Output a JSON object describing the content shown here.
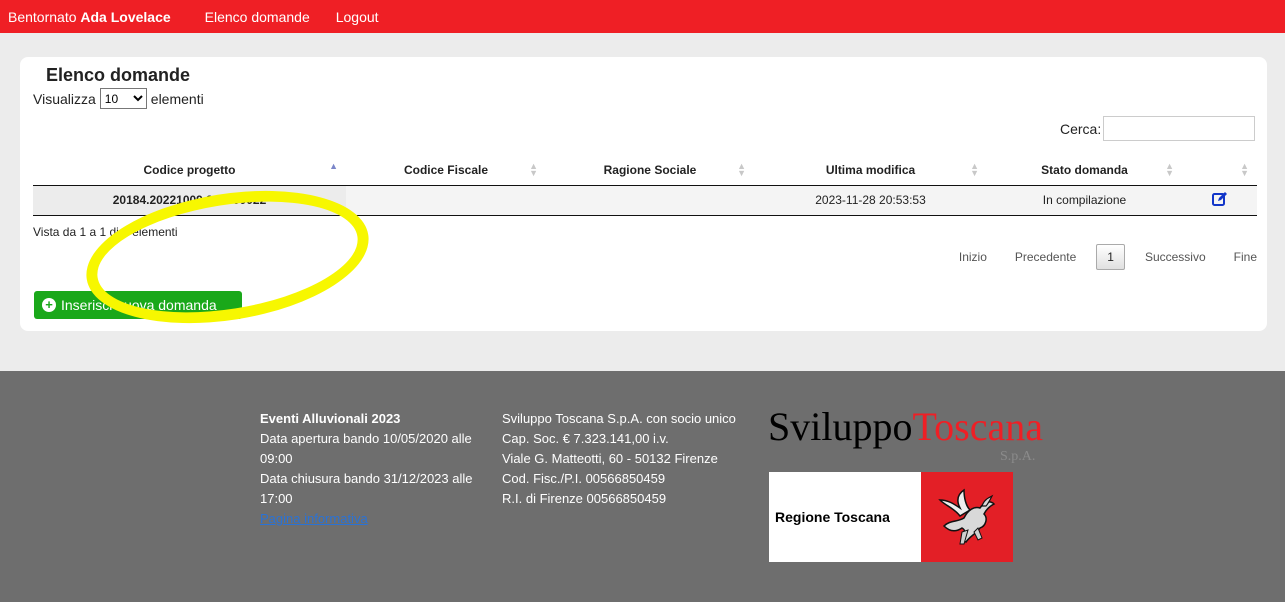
{
  "topbar": {
    "welcome_prefix": "Bentornato",
    "user_name": "Ada Lovelace",
    "nav": [
      "Elenco domande",
      "Logout"
    ]
  },
  "page": {
    "title": "Elenco domande",
    "length_prefix": "Visualizza",
    "length_value": "10",
    "length_suffix": "elementi",
    "search_label": "Cerca:",
    "search_value": ""
  },
  "table": {
    "headers": [
      "Codice progetto",
      "Codice Fiscale",
      "Ragione Sociale",
      "Ultima modifica",
      "Stato domanda",
      ""
    ],
    "rows": [
      {
        "codice_progetto": "20184.20221009.225000022",
        "codice_fiscale": "",
        "ragione_sociale": "",
        "ultima_modifica": "2023-11-28 20:53:53",
        "stato_domanda": "In compilazione",
        "action_icon": "edit-icon"
      }
    ],
    "info": "Vista da 1 a 1 di 1 elementi"
  },
  "pager": {
    "first": "Inizio",
    "previous": "Precedente",
    "current": "1",
    "next": "Successivo",
    "last": "Fine"
  },
  "add_button": {
    "label": "Inserisci nuova domanda",
    "icon": "plus-circle-icon"
  },
  "colors": {
    "topbar": "#ef1f25",
    "footer": "#6e6e6e",
    "add_button": "#1aa81a",
    "highlight": "#f7f700"
  },
  "footer": {
    "col1": {
      "title": "Eventi Alluvionali 2023",
      "apertura": "Data apertura bando 10/05/2020 alle 09:00",
      "chiusura": "Data chiusura bando 31/12/2023 alle 17:00",
      "link": "Pagina informativa"
    },
    "col2": [
      "Sviluppo Toscana S.p.A. con socio unico",
      "Cap. Soc. € 7.323.141,00 i.v.",
      "Viale G. Matteotti, 60 - 50132 Firenze",
      "Cod. Fisc./P.I. 00566850459",
      "R.I. di Firenze 00566850459"
    ],
    "logo_st_a": "Sviluppo",
    "logo_st_b": "Toscana",
    "logo_spa": "S.p.A.",
    "logo_rt": "Regione Toscana"
  }
}
